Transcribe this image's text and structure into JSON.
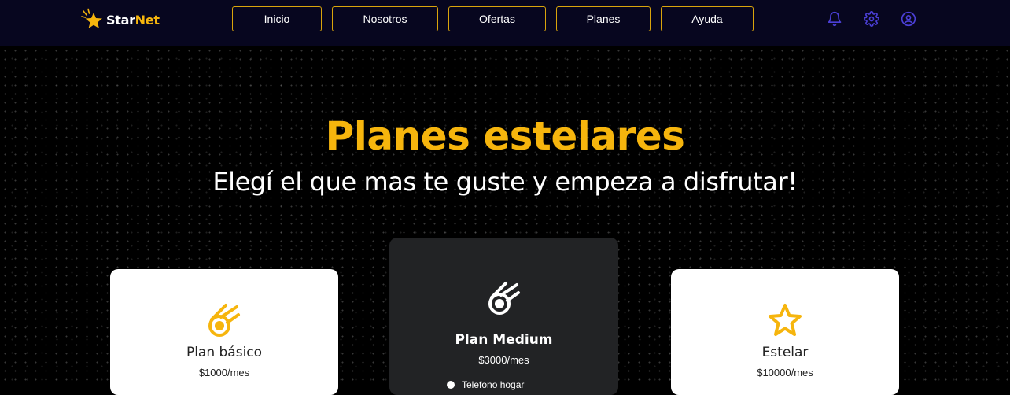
{
  "brand": {
    "star": "Star",
    "net": "Net"
  },
  "nav": [
    {
      "label": "Inicio"
    },
    {
      "label": "Nosotros"
    },
    {
      "label": "Ofertas"
    },
    {
      "label": "Planes"
    },
    {
      "label": "Ayuda"
    }
  ],
  "nav_icons": [
    "bell-icon",
    "gear-icon",
    "user-circle-icon"
  ],
  "hero": {
    "title": "Planes estelares",
    "subtitle": "Elegí el que mas te guste y empeza a disfrutar!"
  },
  "plans": [
    {
      "name": "Plan básico",
      "price": "$1000/mes",
      "icon": "meteor-icon",
      "theme": "light"
    },
    {
      "name": "Plan Medium",
      "price": "$3000/mes",
      "icon": "meteor-icon",
      "theme": "dark",
      "feature": "Telefono hogar"
    },
    {
      "name": "Estelar",
      "price": "$10000/mes",
      "icon": "star-icon",
      "theme": "light"
    }
  ],
  "colors": {
    "accent": "#f6b50d",
    "navbar_bg": "#07061f",
    "nav_icon": "#4b3fd6",
    "card_dark": "#222325",
    "card_light": "#ffffff"
  }
}
